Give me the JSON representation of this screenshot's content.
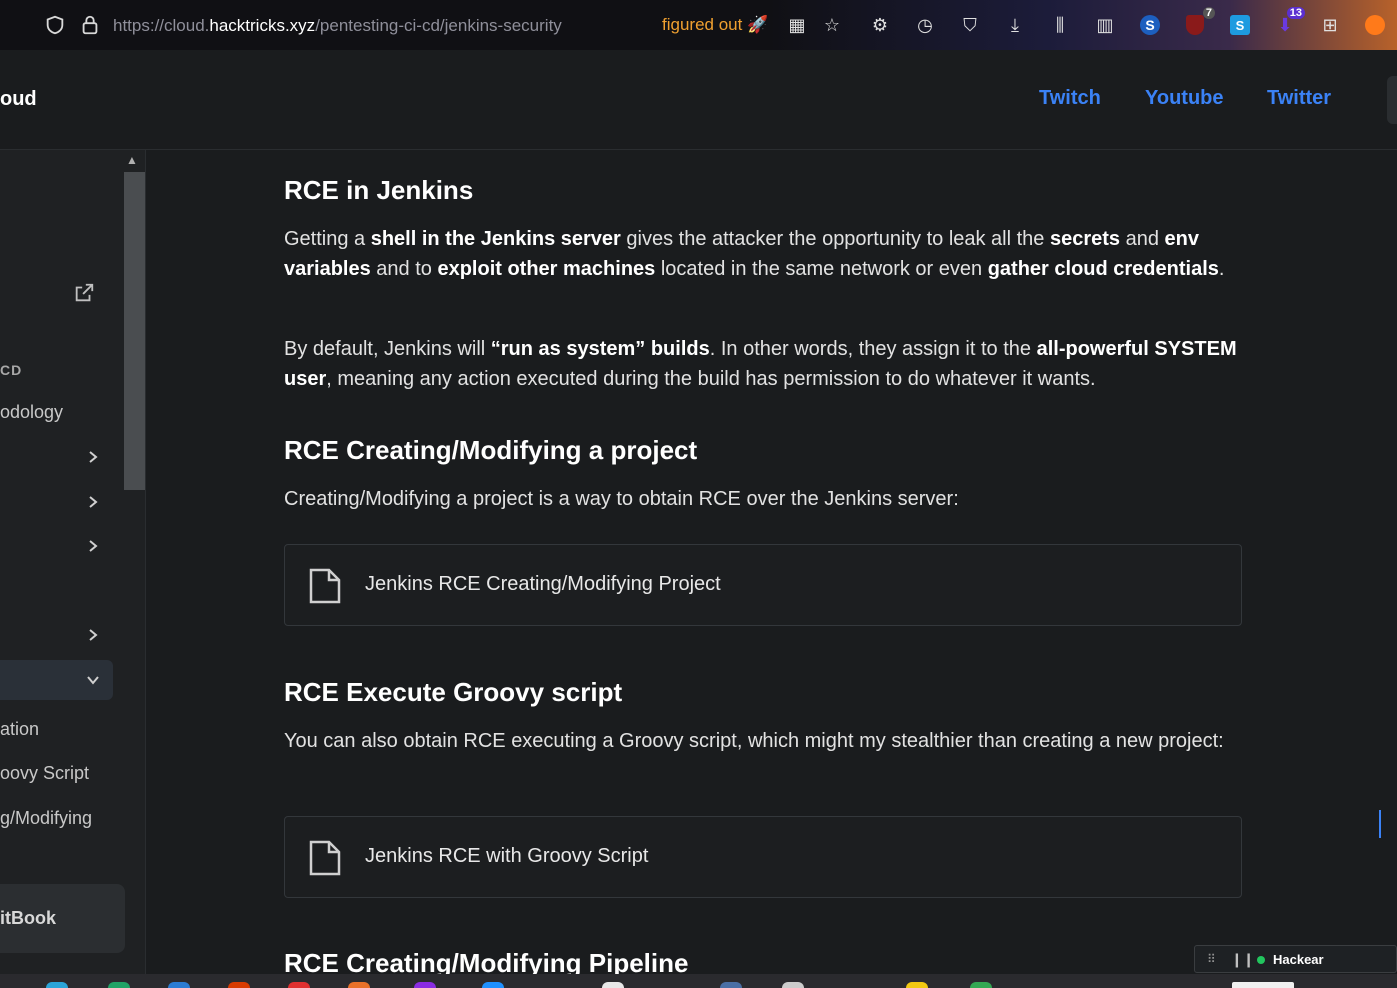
{
  "browser": {
    "url_prefix": "https://cloud.",
    "url_host": "hacktricks.xyz",
    "url_path": "/pentesting-ci-cd/jenkins-security",
    "ext_label": "figured out",
    "badges": {
      "ublock": "7",
      "downloads_ext": "13"
    }
  },
  "header": {
    "title": "oud",
    "links": [
      "Twitch",
      "Youtube",
      "Twitter"
    ]
  },
  "sidebar": {
    "section": "CD",
    "item_methodology": "odology",
    "item_ation": "ation",
    "item_groovy": "oovy Script",
    "item_modifying": "g/Modifying",
    "gitbook": "itBook"
  },
  "content": {
    "h_rce": "RCE in Jenkins",
    "p1": {
      "t1": "Getting a ",
      "b1": "shell in the Jenkins server",
      "t2": " gives the attacker the opportunity to leak all the ",
      "b2": "secrets",
      "t3": " and ",
      "b3": "env variables",
      "t4": " and to ",
      "b4": "exploit other machines",
      "t5": " located in the same network or even ",
      "b5": "gather cloud credentials",
      "t6": "."
    },
    "p2": {
      "t1": "By default, Jenkins will ",
      "b1": "“run as system” builds",
      "t2": ". In other words, they assign it to the ",
      "b2": "all-powerful SYSTEM user",
      "t3": ", meaning any action executed during the build has permission to do whatever it wants."
    },
    "h_project": "RCE Creating/Modifying a project",
    "p_project": "Creating/Modifying a project is a way to obtain RCE over the Jenkins server:",
    "card_project": "Jenkins RCE Creating/Modifying Project",
    "h_groovy": "RCE Execute Groovy script",
    "p_groovy": "You can also obtain RCE executing a Groovy script, which might my stealthier than creating a new project:",
    "card_groovy": "Jenkins RCE with Groovy Script",
    "h_pipeline": "RCE Creating/Modifying Pipeline"
  },
  "widget": {
    "label": "Hackear"
  },
  "colors": {
    "link": "#3b82f6",
    "accent_orange": "#f0a030",
    "status_green": "#22c55e"
  }
}
